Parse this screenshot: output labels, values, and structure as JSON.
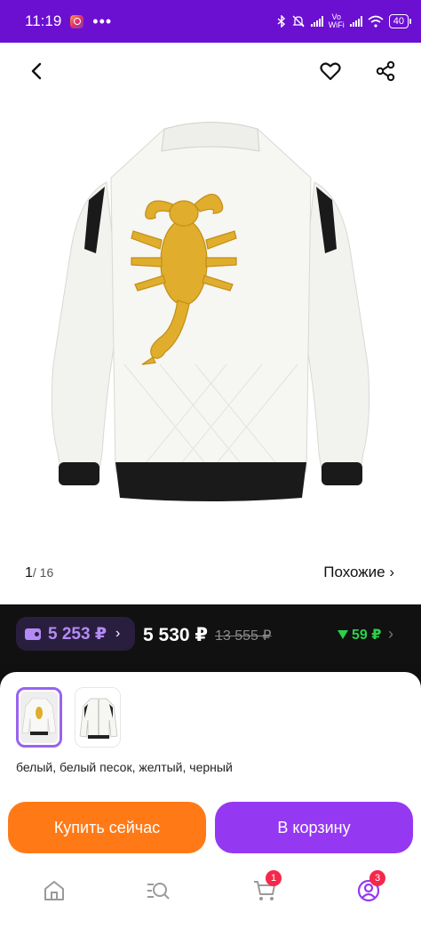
{
  "status_bar": {
    "time": "11:19",
    "dots": "•••",
    "vowifi_top": "Vo",
    "vowifi_bottom": "WiFi",
    "battery": "40"
  },
  "gallery": {
    "current": "1",
    "total": "/ 16",
    "similar_label": "Похожие ›"
  },
  "prices": {
    "wallet_price": "5 253 ₽",
    "wallet_chevron": "›",
    "price": "5 530 ₽",
    "old_price": "13 555 ₽",
    "cashback": "59 ₽",
    "cashback_chevron": "›"
  },
  "variant": {
    "colors_text": "белый, белый песок, желтый, черный"
  },
  "actions": {
    "buy_now": "Купить сейчас",
    "add_to_cart": "В корзину"
  },
  "tabbar": {
    "cart_badge": "1",
    "profile_badge": "3"
  },
  "colors": {
    "brand_purple": "#6b0fd1",
    "buy_orange": "#ff7a17",
    "cart_purple": "#9538f2",
    "cashback_green": "#2bd14a",
    "wallet_price_color": "#b38bf5",
    "badge_red": "#f5284b"
  }
}
